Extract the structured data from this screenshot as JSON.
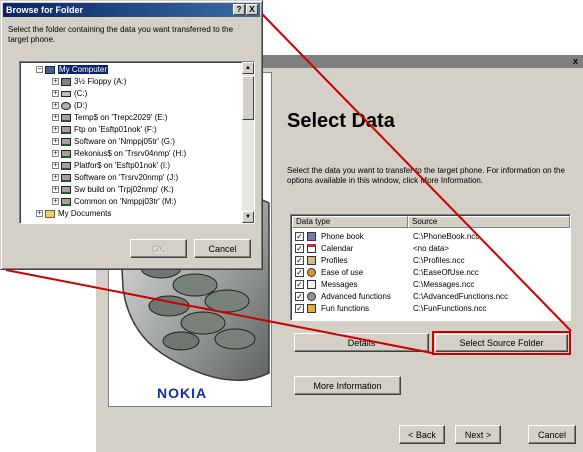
{
  "wizard": {
    "close_glyph": "x",
    "title": "Select Data",
    "description": "Select the data you want to transfer to the target phone. For information on the options available in this window, click More Information.",
    "logo": "NOKIA",
    "columns": {
      "type": "Data type",
      "source": "Source"
    },
    "rows": [
      {
        "name": "Phone book",
        "source": "C:\\PhoneBook.ncc",
        "checked": "✓",
        "icon": "address-book-icon"
      },
      {
        "name": "Calendar",
        "source": "<no data>",
        "checked": "✓",
        "icon": "calendar-icon"
      },
      {
        "name": "Profiles",
        "source": "C:\\Profiles.ncc",
        "checked": "✓",
        "icon": "profiles-icon"
      },
      {
        "name": "Ease of use",
        "source": "C:\\EaseOfUse.ncc",
        "checked": "✓",
        "icon": "ease-of-use-icon"
      },
      {
        "name": "Messages",
        "source": "C:\\Messages.ncc",
        "checked": "✓",
        "icon": "messages-icon"
      },
      {
        "name": "Advanced functions",
        "source": "C:\\AdvancedFunctions.ncc",
        "checked": "✓",
        "icon": "advanced-functions-icon"
      },
      {
        "name": "Fun functions",
        "source": "C:\\FunFunctions.ncc",
        "checked": "✓",
        "icon": "fun-functions-icon"
      }
    ],
    "buttons": {
      "details": "Details",
      "select_source": "Select Source Folder",
      "more_info": "More Information",
      "back": "< Back",
      "next": "Next >",
      "cancel": "Cancel"
    },
    "highlight_color": "#cc0000"
  },
  "browse_dialog": {
    "title": "Browse for Folder",
    "help_glyph": "?",
    "close_glyph": "X",
    "prompt": "Select the folder containing the data you want transferred to the target phone.",
    "tree": [
      {
        "label": "My Computer",
        "selected": true,
        "expander": "−",
        "icon": "computer-icon"
      },
      {
        "label": "3½ Floppy (A:)",
        "expander": "+",
        "icon": "floppy-icon"
      },
      {
        "label": "(C:)",
        "expander": "+",
        "icon": "drive-icon"
      },
      {
        "label": "(D:)",
        "expander": "+",
        "icon": "cd-drive-icon"
      },
      {
        "label": "Temp$ on 'Trepc2029' (E:)",
        "expander": "+",
        "icon": "network-drive-icon"
      },
      {
        "label": "Ftp on 'Esftp01nok' (F:)",
        "expander": "+",
        "icon": "network-drive-icon"
      },
      {
        "label": "Software on 'Nmppj05tr' (G:)",
        "expander": "+",
        "icon": "network-drive-icon"
      },
      {
        "label": "Rekonius$ on 'Trsrv04nmp' (H:)",
        "expander": "+",
        "icon": "network-drive-icon"
      },
      {
        "label": "Platfor$ on 'Esftp01nok' (I:)",
        "expander": "+",
        "icon": "network-drive-icon"
      },
      {
        "label": "Software on 'Trsrv20nmp' (J:)",
        "expander": "+",
        "icon": "network-drive-icon"
      },
      {
        "label": "Sw build on 'Trpj02nmp' (K:)",
        "expander": "+",
        "icon": "network-drive-icon"
      },
      {
        "label": "Common on 'Nmppj03tr' (M:)",
        "expander": "+",
        "icon": "network-drive-icon"
      },
      {
        "label": "My Documents",
        "expander": "+",
        "icon": "folder-icon"
      }
    ],
    "scroll_up_glyph": "▲",
    "scroll_down_glyph": "▼",
    "ok": "OK",
    "cancel": "Cancel"
  }
}
